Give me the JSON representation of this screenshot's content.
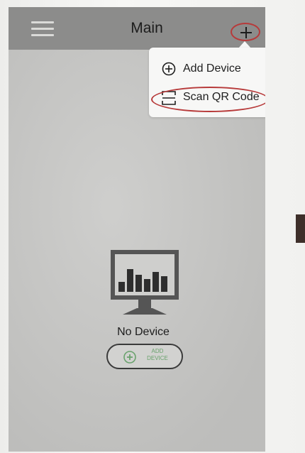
{
  "header": {
    "title": "Main",
    "menu_icon": "hamburger-menu-icon",
    "add_icon": "plus-icon"
  },
  "dropdown": {
    "items": [
      {
        "label": "Add Device",
        "icon": "circle-plus-icon"
      },
      {
        "label": "Scan QR Code",
        "icon": "scan-frame-icon",
        "highlighted": true
      }
    ]
  },
  "empty_state": {
    "icon": "monitor-bar-chart-icon",
    "message": "No Device",
    "button_label": "ADD DEVICE",
    "button_icon": "circle-plus-icon"
  },
  "colors": {
    "nav_bar": "#8c8c8b",
    "screen_background": "#c9c9c7",
    "highlight_circle": "#b73a3a",
    "button_text": "#69a26c"
  }
}
